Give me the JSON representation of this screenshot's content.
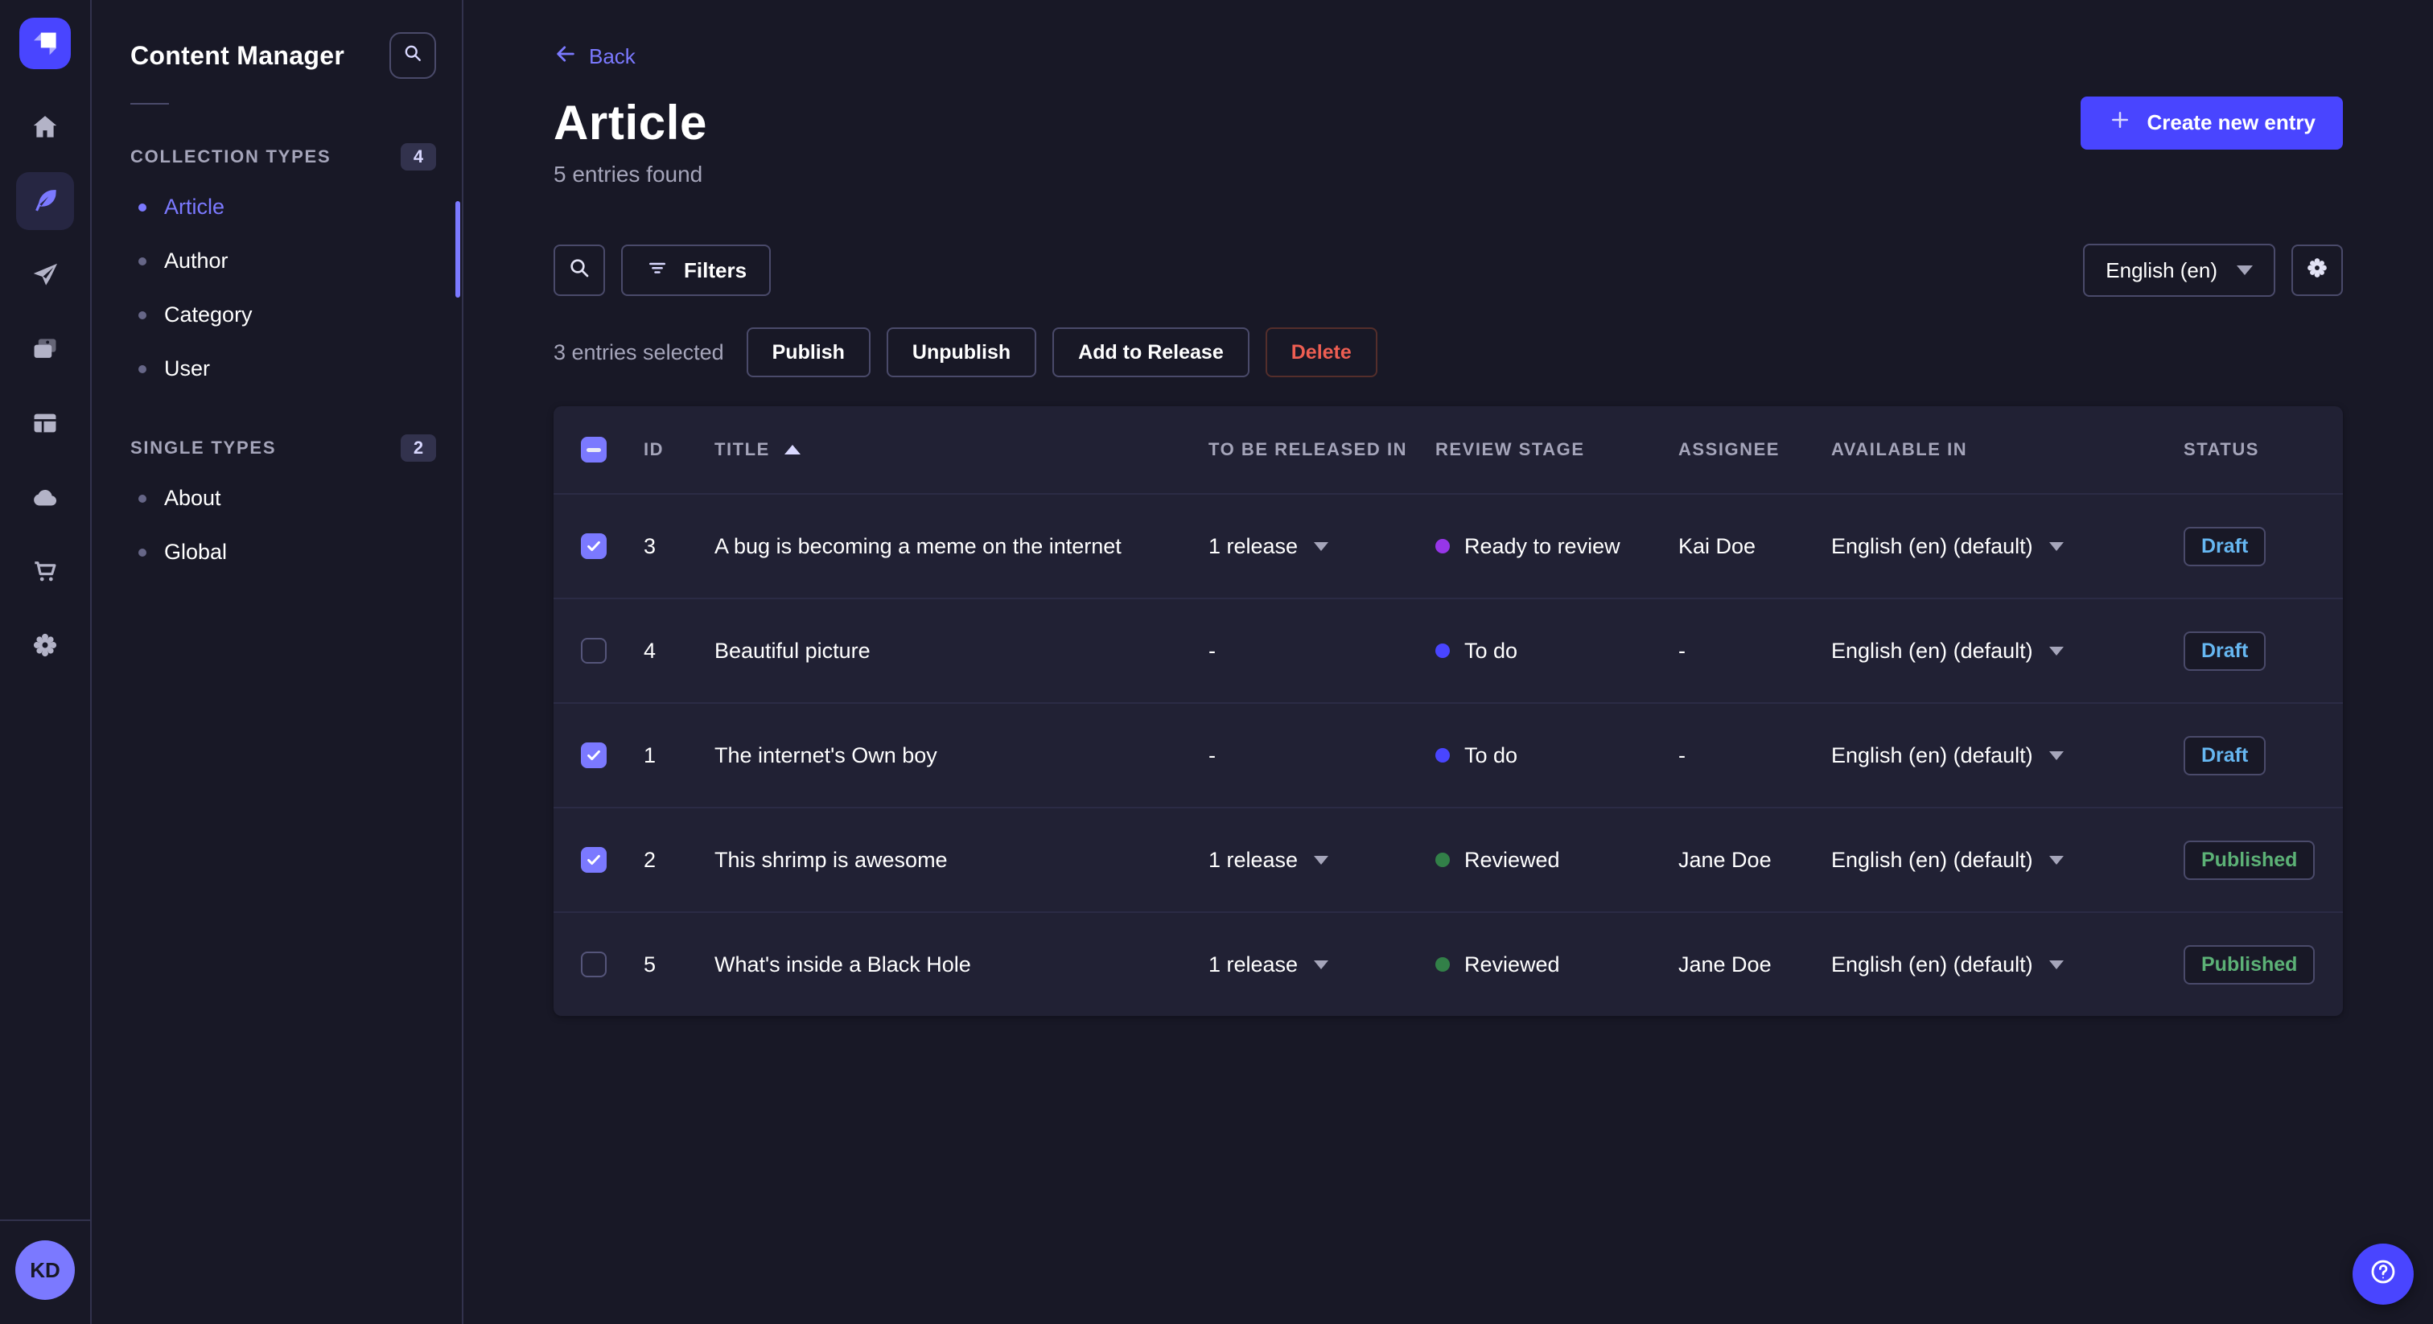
{
  "colors": {
    "accent": "#4945ff",
    "accent_light": "#7b79ff",
    "draft": "#66b7f1",
    "published": "#5cb176",
    "danger": "#ee5e52"
  },
  "rail": {
    "logo": "strapi-logo",
    "items": [
      {
        "name": "home-icon",
        "active": false
      },
      {
        "name": "feather-icon",
        "active": true
      },
      {
        "name": "paper-plane-icon",
        "active": false
      },
      {
        "name": "media-icon",
        "active": false
      },
      {
        "name": "layout-icon",
        "active": false
      },
      {
        "name": "cloud-icon",
        "active": false
      },
      {
        "name": "cart-icon",
        "active": false
      },
      {
        "name": "gear-icon",
        "active": false
      }
    ],
    "avatar_initials": "KD"
  },
  "sidebar": {
    "title": "Content Manager",
    "sections": [
      {
        "label": "COLLECTION TYPES",
        "badge": "4",
        "items": [
          {
            "label": "Article",
            "active": true
          },
          {
            "label": "Author",
            "active": false
          },
          {
            "label": "Category",
            "active": false
          },
          {
            "label": "User",
            "active": false
          }
        ]
      },
      {
        "label": "SINGLE TYPES",
        "badge": "2",
        "items": [
          {
            "label": "About",
            "active": false
          },
          {
            "label": "Global",
            "active": false
          }
        ]
      }
    ]
  },
  "header": {
    "back_label": "Back",
    "title": "Article",
    "subtitle": "5 entries found",
    "create_label": "Create new entry"
  },
  "toolbar": {
    "filters_label": "Filters",
    "locale": "English (en)"
  },
  "selection": {
    "text": "3 entries selected",
    "actions": [
      {
        "label": "Publish",
        "variant": "default"
      },
      {
        "label": "Unpublish",
        "variant": "default"
      },
      {
        "label": "Add to Release",
        "variant": "default"
      },
      {
        "label": "Delete",
        "variant": "danger"
      }
    ]
  },
  "table": {
    "header_checkbox": "indeterminate",
    "columns": [
      "ID",
      "TITLE",
      "TO BE RELEASED IN",
      "REVIEW STAGE",
      "ASSIGNEE",
      "AVAILABLE IN",
      "STATUS"
    ],
    "sorted_column": "TITLE",
    "sort_direction": "asc",
    "rows": [
      {
        "checked": true,
        "id": "3",
        "title": "A bug is becoming a meme on the internet",
        "released": "1 release",
        "review": "Ready to review",
        "review_color": "#9736e8",
        "assignee": "Kai Doe",
        "available": "English (en) (default)",
        "status": "Draft"
      },
      {
        "checked": false,
        "id": "4",
        "title": "Beautiful picture",
        "released": "-",
        "review": "To do",
        "review_color": "#4945ff",
        "assignee": "-",
        "available": "English (en) (default)",
        "status": "Draft"
      },
      {
        "checked": true,
        "id": "1",
        "title": "The internet's Own boy",
        "released": "-",
        "review": "To do",
        "review_color": "#4945ff",
        "assignee": "-",
        "available": "English (en) (default)",
        "status": "Draft"
      },
      {
        "checked": true,
        "id": "2",
        "title": "This shrimp is awesome",
        "released": "1 release",
        "review": "Reviewed",
        "review_color": "#328048",
        "assignee": "Jane Doe",
        "available": "English (en) (default)",
        "status": "Published"
      },
      {
        "checked": false,
        "id": "5",
        "title": "What's inside a Black Hole",
        "released": "1 release",
        "review": "Reviewed",
        "review_color": "#328048",
        "assignee": "Jane Doe",
        "available": "English (en) (default)",
        "status": "Published"
      }
    ]
  },
  "help": {
    "icon": "question-circle-icon"
  }
}
